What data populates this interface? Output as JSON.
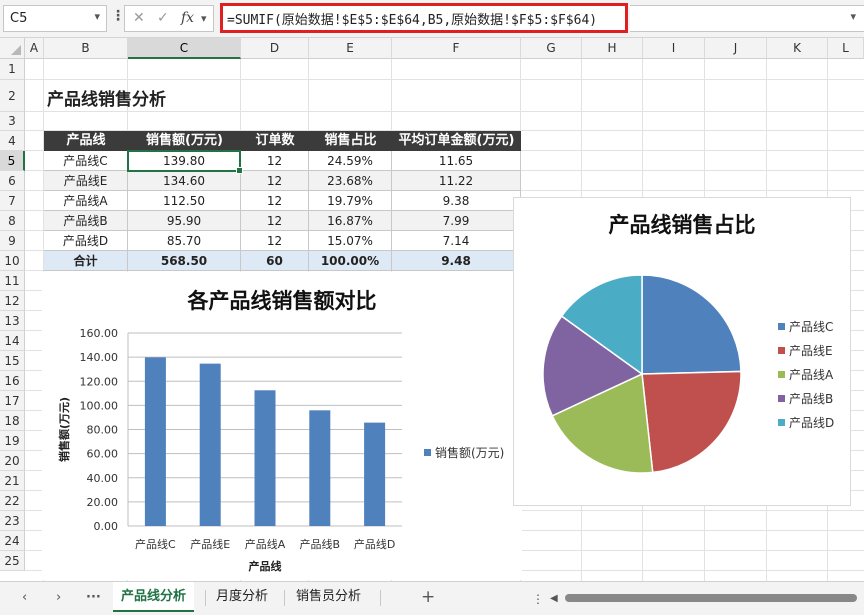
{
  "formula_bar": {
    "name_box": "C5",
    "formula": "=SUMIF(原始数据!$E$5:$E$64,B5,原始数据!$F$5:$F$64)"
  },
  "columns": [
    "A",
    "B",
    "C",
    "D",
    "E",
    "F",
    "G",
    "H",
    "I",
    "J",
    "K",
    "L"
  ],
  "rows": [
    "1",
    "2",
    "3",
    "4",
    "5",
    "6",
    "7",
    "8",
    "9",
    "10",
    "11",
    "12",
    "13",
    "14",
    "15",
    "16",
    "17",
    "18",
    "19",
    "20",
    "21",
    "22",
    "23",
    "24",
    "25"
  ],
  "sheet": {
    "title": "产品线销售分析",
    "table": {
      "headers": [
        "产品线",
        "销售额(万元)",
        "订单数",
        "销售占比",
        "平均订单金额(万元)"
      ],
      "rows": [
        [
          "产品线C",
          "139.80",
          "12",
          "24.59%",
          "11.65"
        ],
        [
          "产品线E",
          "134.60",
          "12",
          "23.68%",
          "11.22"
        ],
        [
          "产品线A",
          "112.50",
          "12",
          "19.79%",
          "9.38"
        ],
        [
          "产品线B",
          "95.90",
          "12",
          "16.87%",
          "7.99"
        ],
        [
          "产品线D",
          "85.70",
          "12",
          "15.07%",
          "7.14"
        ]
      ],
      "total": [
        "合计",
        "568.50",
        "60",
        "100.00%",
        "9.48"
      ]
    }
  },
  "chart_data": [
    {
      "type": "bar",
      "title": "各产品线销售额对比",
      "categories": [
        "产品线C",
        "产品线E",
        "产品线A",
        "产品线B",
        "产品线D"
      ],
      "series": [
        {
          "name": "销售额(万元)",
          "values": [
            139.8,
            134.6,
            112.5,
            95.9,
            85.7
          ]
        }
      ],
      "xlabel": "产品线",
      "ylabel": "销售额(万元)",
      "ylim": [
        0,
        160
      ],
      "yticks": [
        "0.00",
        "20.00",
        "40.00",
        "60.00",
        "80.00",
        "100.00",
        "120.00",
        "140.00",
        "160.00"
      ],
      "grid": true,
      "legend": "right",
      "color": "#4f81bd"
    },
    {
      "type": "pie",
      "title": "产品线销售占比",
      "labels": [
        "产品线C",
        "产品线E",
        "产品线A",
        "产品线B",
        "产品线D"
      ],
      "values": [
        24.59,
        23.68,
        19.79,
        16.87,
        15.07
      ],
      "colors": [
        "#4f81bd",
        "#c0504d",
        "#9bbb59",
        "#8064a2",
        "#4bacc6"
      ],
      "legend": "right"
    }
  ],
  "tabs": {
    "items": [
      "产品线分析",
      "月度分析",
      "销售员分析"
    ],
    "active": "产品线分析",
    "more": "···",
    "add": "+"
  },
  "icons": {
    "cancel": "close-icon",
    "enter": "check-icon",
    "fx": "fx"
  }
}
